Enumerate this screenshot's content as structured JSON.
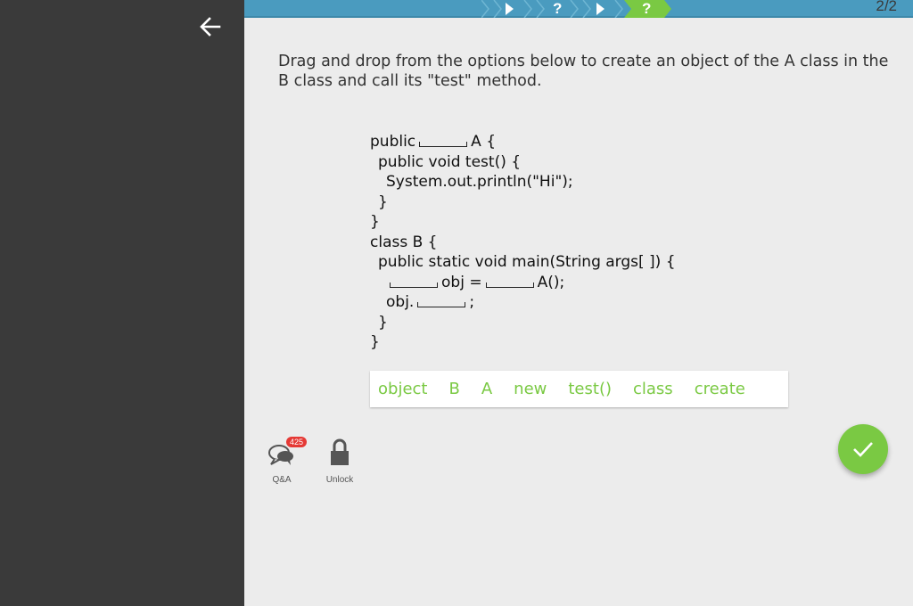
{
  "header": {
    "page_count": "2/2",
    "steps": [
      {
        "icon": "play-icon",
        "label": ""
      },
      {
        "icon": "question-icon",
        "label": "?"
      },
      {
        "icon": "play-icon",
        "label": ""
      },
      {
        "icon": "question-icon",
        "label": "?",
        "active": true
      }
    ]
  },
  "instruction": "Drag and drop from the options below to create an object of the A class in the B class and call its \"test\" method.",
  "code": {
    "l1a": "public",
    "l1b": "A {",
    "l2": "public void test() {",
    "l3": "System.out.println(\"Hi\");",
    "l4": "}",
    "l5": "}",
    "l6": "class B {",
    "l7": "public static void main(String args[ ]) {",
    "l8a": "obj =",
    "l8b": "A();",
    "l9a": "obj.",
    "l9b": ";",
    "l10": "}",
    "l11": "}"
  },
  "options": [
    "object",
    "B",
    "A",
    "new",
    "test()",
    "class",
    "create"
  ],
  "tools": {
    "qa_label": "Q&A",
    "qa_count": "425",
    "unlock_label": "Unlock"
  },
  "colors": {
    "accent_green": "#7ac943",
    "topbar_blue": "#4a9bbf",
    "badge_red": "#e53935"
  }
}
